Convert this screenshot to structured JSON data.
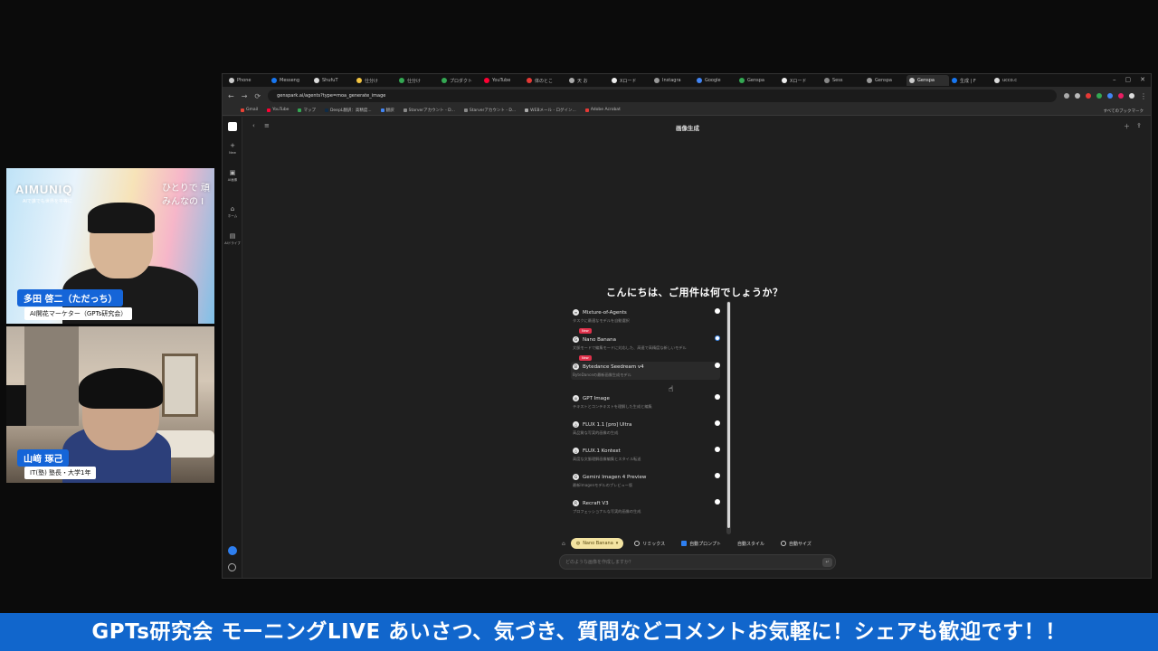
{
  "cam1": {
    "brand": "AIMUNIQ",
    "brand_sub": "AIで誰でも世界を平等に",
    "slogan_line1": "ひとりで 頑",
    "slogan_line2": "みんなの I",
    "name": "多田 啓二（ただっち）",
    "role": "AI開花マーケター（GPTs研究会）"
  },
  "cam2": {
    "name": "山﨑 琢己",
    "role": "IT(塾) 塾長・大学1年"
  },
  "browser": {
    "tabs": [
      {
        "label": "Phone",
        "color": "#cccccc"
      },
      {
        "label": "Messeng",
        "color": "#1877f2"
      },
      {
        "label": "ShufuT",
        "color": "#dddddd"
      },
      {
        "label": "仕分け",
        "color": "#f4c542"
      },
      {
        "label": "仕分け",
        "color": "#34a853"
      },
      {
        "label": "プロダクト",
        "color": "#34a853"
      },
      {
        "label": "YouTube",
        "color": "#ff0033"
      },
      {
        "label": "体のとこ",
        "color": "#e53935"
      },
      {
        "label": "天 お ",
        "color": "#aaaaaa"
      },
      {
        "label": "Xロード",
        "color": "#eeeeee"
      },
      {
        "label": "Instagra",
        "color": "#999999"
      },
      {
        "label": "Google",
        "color": "#4285f4"
      },
      {
        "label": "Genspa",
        "color": "#34a853"
      },
      {
        "label": "Xロード",
        "color": "#eeeeee"
      },
      {
        "label": "Sess",
        "color": "#888888"
      },
      {
        "label": "Genspa",
        "color": "#999999"
      },
      {
        "label": "Genspa",
        "color": "#cccccc"
      },
      {
        "label": "生成 | F",
        "color": "#1877f2"
      },
      {
        "label": "ucco.c",
        "color": "#dddddd"
      }
    ],
    "url": "genspark.ai/agents?type=moa_generate_image",
    "bookmarks": [
      {
        "label": "Gmail",
        "color": "#ea4335"
      },
      {
        "label": "YouTube",
        "color": "#ff0033"
      },
      {
        "label": "マップ",
        "color": "#34a853"
      },
      {
        "label": "DeepL翻訳：高精度...",
        "color": "#0f2b46"
      },
      {
        "label": "翻訳",
        "color": "#4285f4"
      },
      {
        "label": "Starverアカウント - D...",
        "color": "#888888"
      },
      {
        "label": "Starverアカウント - D...",
        "color": "#888888"
      },
      {
        "label": "WEBメール - ログイン...",
        "color": "#aaaaaa"
      },
      {
        "label": "Adobe Acrobat",
        "color": "#e53935"
      }
    ],
    "bookmarks_right": "すべてのブックマーク"
  },
  "app": {
    "title": "画像生成",
    "sidebar": [
      {
        "icon": "+",
        "label": "New"
      },
      {
        "icon": "▣",
        "label": "AI画像"
      },
      {
        "icon": "⌂",
        "label": "ホーム"
      },
      {
        "icon": "▤",
        "label": "AIドライブ"
      }
    ],
    "greeting": "こんにちは、ご用件は何でしょうか？",
    "models": [
      {
        "name": "Mixture-of-Agents",
        "desc": "タスクに最適なモデルを自動選択",
        "icon": "≡",
        "selected": false,
        "new": false
      },
      {
        "name": "Nano Banana",
        "desc": "文脈モードで編集モードに対応した、高速で高精度な新しいモデル",
        "icon": "G",
        "selected": true,
        "new": true
      },
      {
        "name": "Bytedance Seedream v4",
        "desc": "ByteDanceの最新画像生成モデル",
        "icon": "B",
        "selected": false,
        "new": true
      },
      {
        "name": "GPT Image",
        "desc": "テキストとコンテキストを理解した生成と編集",
        "icon": "◎",
        "selected": false,
        "new": false
      },
      {
        "name": "FLUX 1.1 [pro] Ultra",
        "desc": "高品質な写実的画像の生成",
        "icon": "△",
        "selected": false,
        "new": false
      },
      {
        "name": "FLUX.1 Kontext",
        "desc": "高度な文脈理解画像編集とスタイル転送",
        "icon": "△",
        "selected": false,
        "new": false
      },
      {
        "name": "Gemini Imagen 4 Preview",
        "desc": "最新Imagenモデルのプレビュー版",
        "icon": "G",
        "selected": false,
        "new": false
      },
      {
        "name": "Recraft V3",
        "desc": "プロフェッショナルな写実的画像の生成",
        "icon": "R",
        "selected": false,
        "new": false
      }
    ],
    "new_badge": "New",
    "toolbar": {
      "model_pill": "Nano Banana",
      "remix": "リミックス",
      "auto_prompt": "自動プロンプト",
      "auto_style": "自動スタイル",
      "auto_size": "自動サイズ"
    },
    "prompt_placeholder": "どのような画像を作成しますか？"
  },
  "banner": "GPTs研究会 モーニングLIVE あいさつ、気づき、質問などコメントお気軽に！シェアも歓迎です！！"
}
